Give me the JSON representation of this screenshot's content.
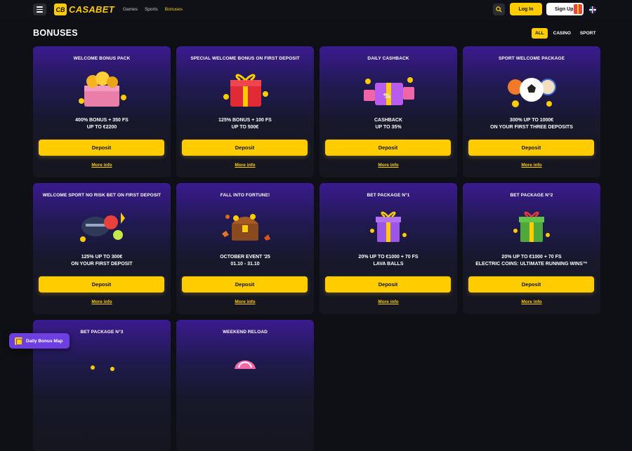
{
  "header": {
    "logo_badge": "CB",
    "logo_text": "CASABET",
    "nav": [
      {
        "label": "Games",
        "active": false
      },
      {
        "label": "Sports",
        "active": false
      },
      {
        "label": "Bonuses",
        "active": true
      }
    ],
    "login_label": "Log In",
    "signup_label": "Sign Up"
  },
  "page": {
    "title": "BONUSES",
    "filters": [
      {
        "label": "ALL",
        "active": true
      },
      {
        "label": "CASINO",
        "active": false
      },
      {
        "label": "SPORT",
        "active": false
      }
    ]
  },
  "deposit_label": "Deposit",
  "more_info_label": "More info",
  "cards": [
    {
      "title": "WELCOME BONUS PACK",
      "offer_line1": "400% BONUS + 350 FS",
      "offer_line2": "UP TO €2200",
      "art": "gold-boxes-icon"
    },
    {
      "title": "SPECIAL WELCOME BONUS ON FIRST DEPOSIT",
      "offer_line1": "125% BONUS + 100 FS",
      "offer_line2": "UP TO 500€",
      "art": "red-gift-icon"
    },
    {
      "title": "DAILY CASHBACK",
      "offer_line1": "CASHBACK",
      "offer_line2": "UP TO 35%",
      "art": "percent-gifts-icon"
    },
    {
      "title": "SPORT WELCOME PACKAGE",
      "offer_line1": "300% UP TO 1000€",
      "offer_line2": "ON YOUR FIRST THREE DEPOSITS",
      "art": "sport-balls-icon"
    },
    {
      "title": "WELCOME SPORT NO RISK BET ON FIRST DEPOSIT",
      "offer_line1": "125% UP TO 300€",
      "offer_line2": "ON YOUR FIRST DEPOSIT",
      "art": "sport-gear-icon"
    },
    {
      "title": "FALL INTO FORTUNE!",
      "offer_line1": "OCTOBER EVENT '25",
      "offer_line2": "01.10 - 31.10",
      "art": "treasure-chest-icon"
    },
    {
      "title": "BET PACKAGE N°1",
      "offer_line1": "20% UP TO €1000 + 70 FS",
      "offer_line2": "LAVA BALLS",
      "art": "purple-gift-icon"
    },
    {
      "title": "BET PACKAGE N°2",
      "offer_line1": "20% UP TO €1000 + 70 FS",
      "offer_line2": "ELECTRIC COINS: ULTIMATE RUNNING WINS™",
      "art": "green-gift-icon"
    },
    {
      "title": "BET PACKAGE N°3",
      "offer_line1": "",
      "offer_line2": "",
      "art": "gift-icon"
    },
    {
      "title": "WEEKEND RELOAD",
      "offer_line1": "",
      "offer_line2": "",
      "art": "pink-gift-icon"
    }
  ],
  "daily_map_label": "Daily Bonus Map",
  "colors": {
    "accent": "#ffcc00",
    "background": "#0f1015",
    "card_top": "#3b1a8f",
    "daily_map": "#6d3fe0"
  }
}
